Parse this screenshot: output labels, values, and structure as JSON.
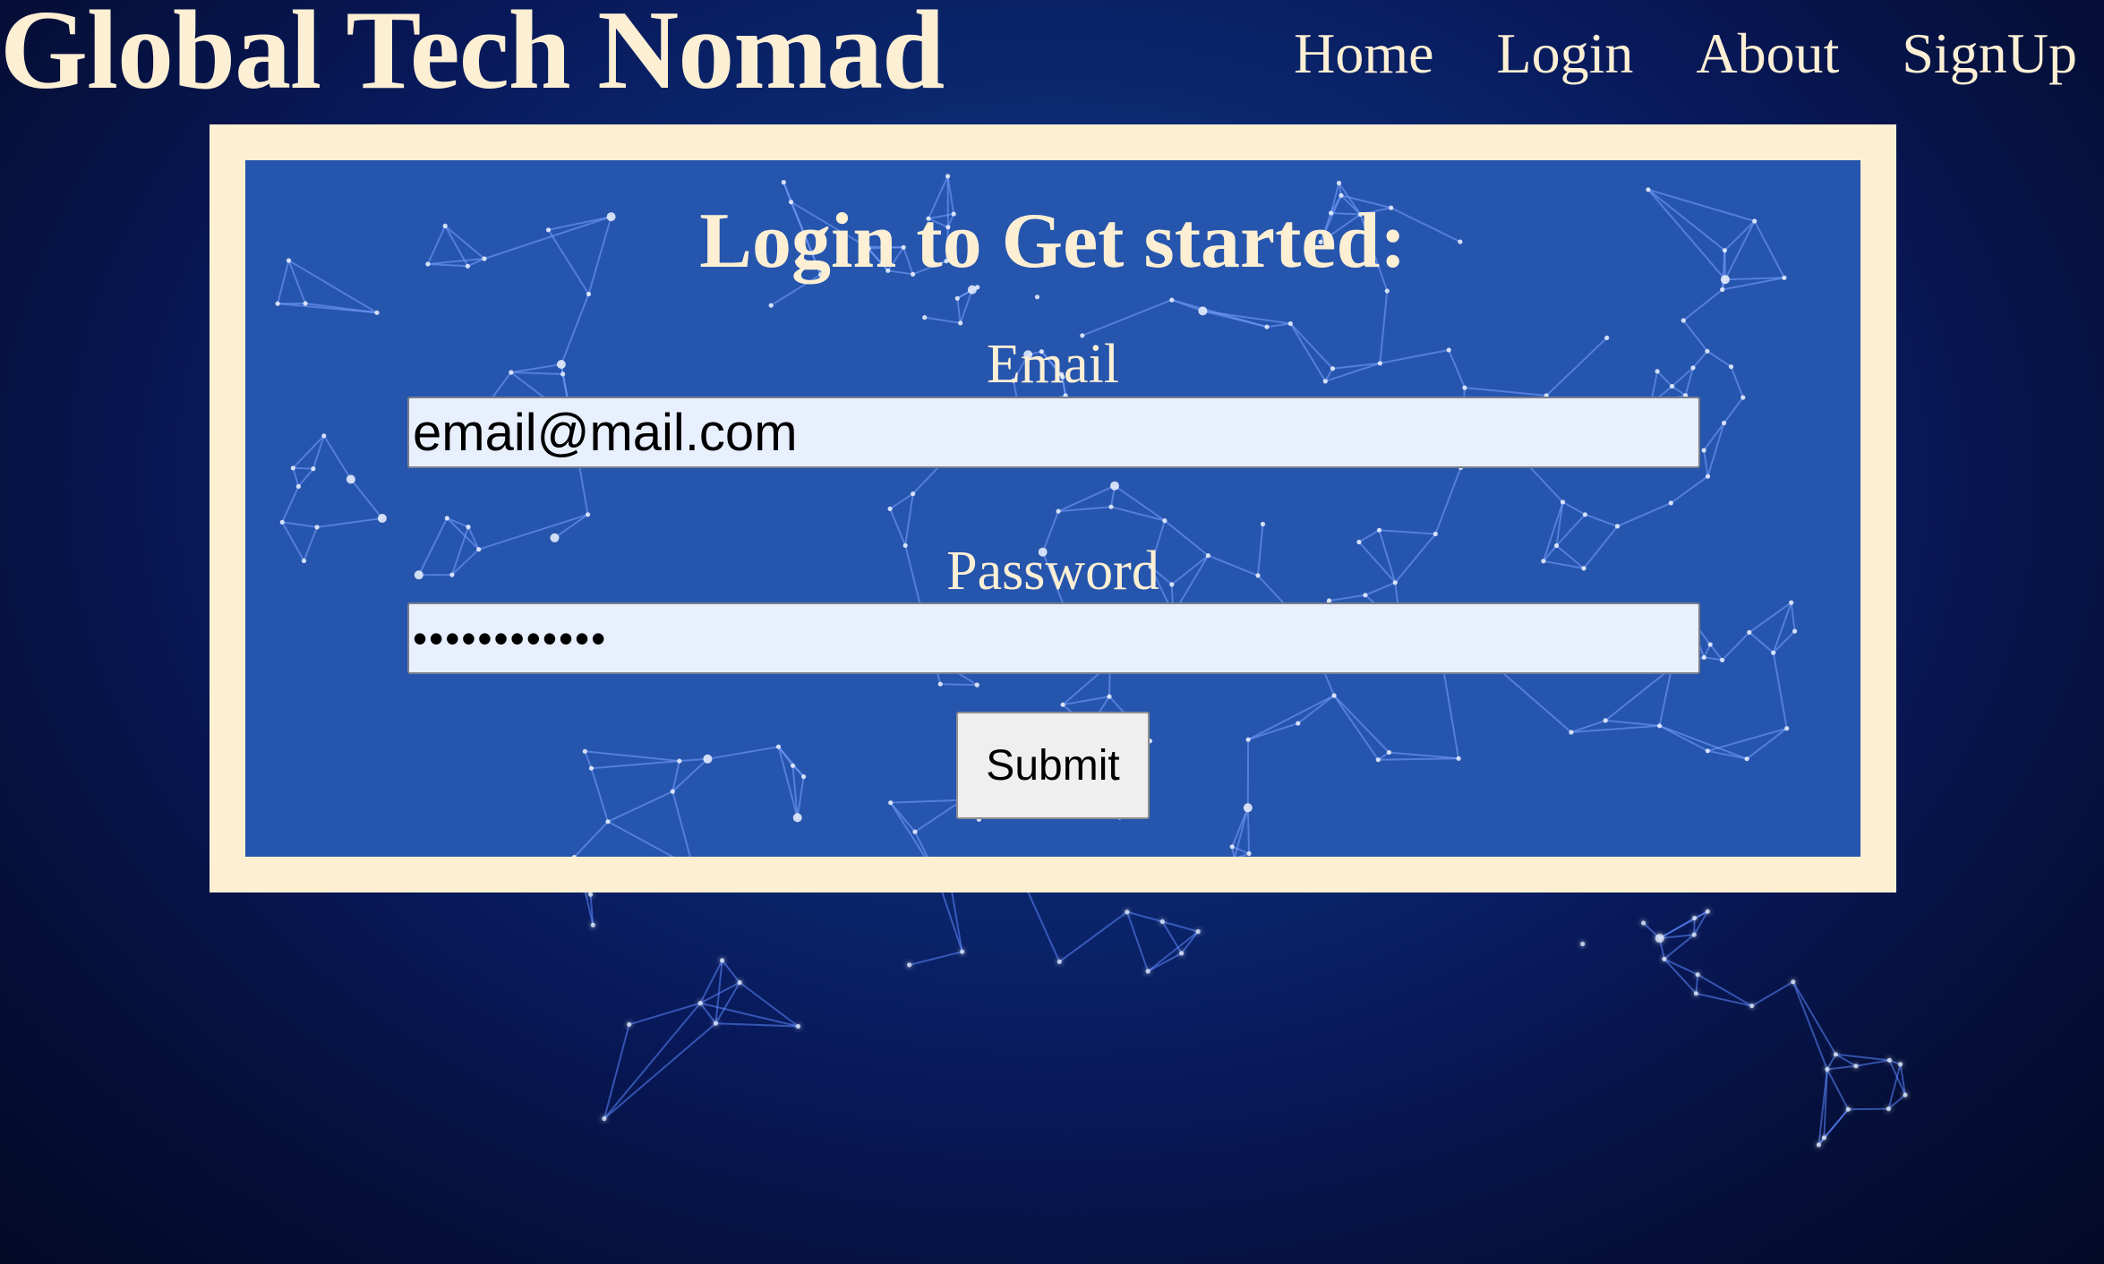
{
  "site": {
    "title": "Global Tech Nomad"
  },
  "nav": {
    "items": [
      {
        "id": "home",
        "label": "Home"
      },
      {
        "id": "login",
        "label": "Login"
      },
      {
        "id": "about",
        "label": "About"
      },
      {
        "id": "signup",
        "label": "SignUp"
      }
    ]
  },
  "login_form": {
    "heading": "Login to Get started:",
    "email": {
      "label": "Email",
      "value": "email@mail.com"
    },
    "password": {
      "label": "Password",
      "value": "••••••••••••"
    },
    "submit_label": "Submit"
  },
  "colors": {
    "text_cream": "#fcefd4",
    "frame_cream": "#fcefd2",
    "panel_blue": "#2655ad",
    "page_navy": "#08195a",
    "input_fill": "#e8f0fe",
    "network_lines": "#5b86ff",
    "network_nodes": "#e8f2ff"
  },
  "background_image": "world-network-map"
}
